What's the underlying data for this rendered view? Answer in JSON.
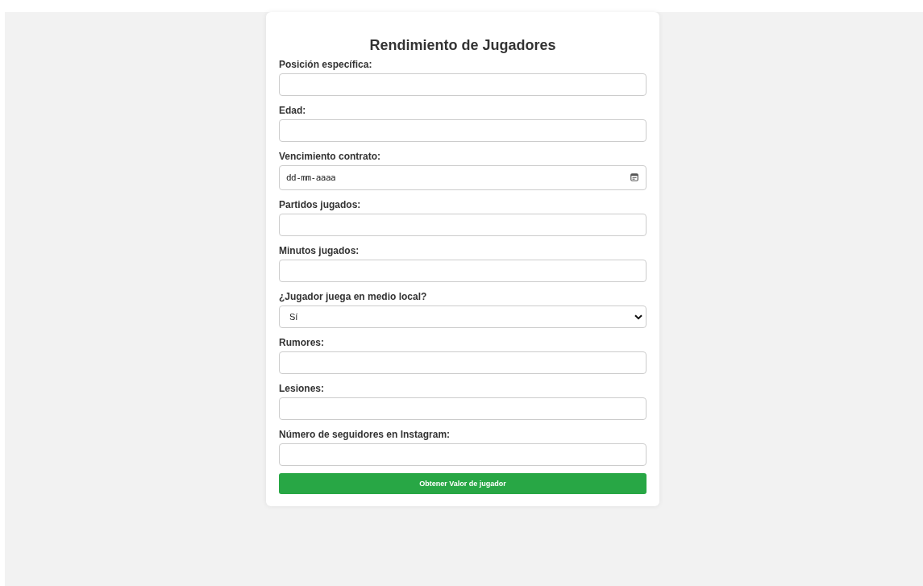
{
  "form": {
    "title": "Rendimiento de Jugadores",
    "fields": [
      {
        "label": "Posición específica:",
        "kind": "text"
      },
      {
        "label": "Edad:",
        "kind": "text"
      },
      {
        "label": "Vencimiento contrato:",
        "kind": "date",
        "placeholder": "dd-mm-aaaa"
      },
      {
        "label": "Partidos jugados:",
        "kind": "text"
      },
      {
        "label": "Minutos jugados:",
        "kind": "text"
      },
      {
        "label": "¿Jugador juega en medio local?",
        "kind": "select",
        "value": "Sí"
      },
      {
        "label": "Rumores:",
        "kind": "text"
      },
      {
        "label": "Lesiones:",
        "kind": "text"
      },
      {
        "label": "Número de seguidores en Instagram:",
        "kind": "text"
      }
    ],
    "submit_button": "Obtener Valor de jugador"
  }
}
